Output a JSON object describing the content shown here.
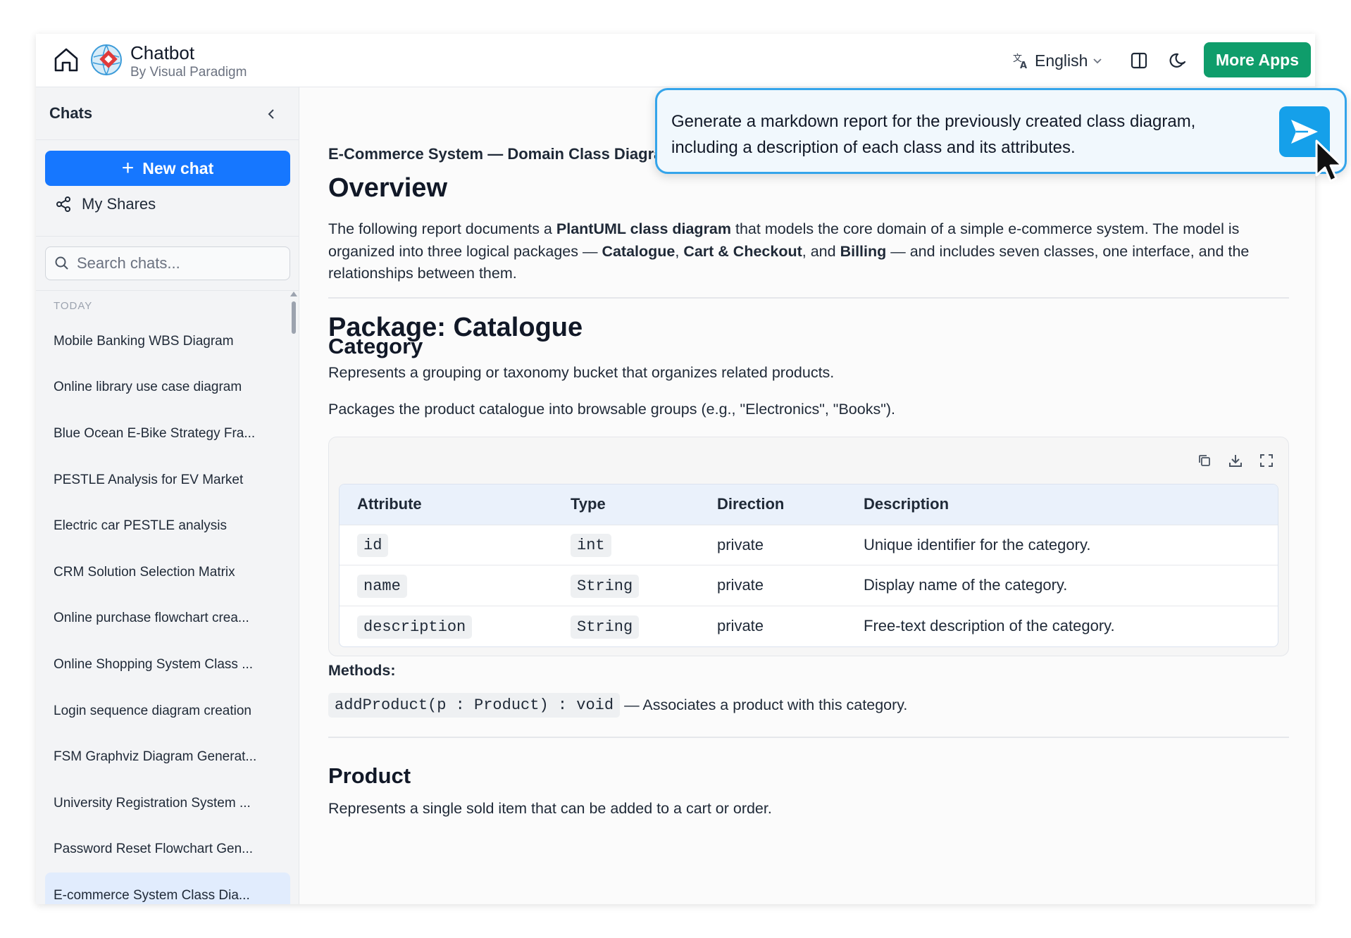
{
  "header": {
    "brand_title": "Chatbot",
    "brand_subtitle": "By Visual Paradigm",
    "language": "English",
    "more_apps_label": "More Apps"
  },
  "sidebar": {
    "title": "Chats",
    "new_chat_label": "New chat",
    "my_shares_label": "My Shares",
    "search_placeholder": "Search chats...",
    "section_label": "TODAY",
    "items": [
      {
        "label": "Mobile Banking WBS Diagram"
      },
      {
        "label": "Online library use case diagram"
      },
      {
        "label": "Blue Ocean E-Bike Strategy Fra..."
      },
      {
        "label": "PESTLE Analysis for EV Market"
      },
      {
        "label": "Electric car PESTLE analysis"
      },
      {
        "label": "CRM Solution Selection Matrix"
      },
      {
        "label": "Online purchase flowchart crea..."
      },
      {
        "label": "Online Shopping System Class ..."
      },
      {
        "label": "Login sequence diagram creation"
      },
      {
        "label": "FSM Graphviz Diagram Generat..."
      },
      {
        "label": "University Registration System ..."
      },
      {
        "label": "Password Reset Flowchart Gen..."
      },
      {
        "label": "E-commerce System Class Dia..."
      }
    ]
  },
  "document": {
    "title": "E-Commerce System — Domain Class Diagram",
    "overview_heading": "Overview",
    "overview_p1_a": "The following report documents a ",
    "overview_p1_b": "PlantUML class diagram",
    "overview_p1_c": " that models the core domain of a simple e-commerce system. The model is organized into three logical packages — ",
    "overview_p1_d": "Catalogue",
    "overview_p1_e": ", ",
    "overview_p1_f": "Cart & Checkout",
    "overview_p1_g": ", and ",
    "overview_p1_h": "Billing",
    "overview_p1_i": " — and includes seven classes, one interface, and the relationships between them.",
    "package_heading": "Package: Catalogue",
    "category_heading": "Category",
    "category_desc": "Represents a grouping or taxonomy bucket that organizes related products.",
    "category_note": "Packages the product catalogue into browsable groups (e.g., \"Electronics\", \"Books\").",
    "table": {
      "headers": [
        "Attribute",
        "Type",
        "Direction",
        "Description"
      ],
      "rows": [
        {
          "attribute": "id",
          "type": "int",
          "direction": "private",
          "description": "Unique identifier for the category."
        },
        {
          "attribute": "name",
          "type": "String",
          "direction": "private",
          "description": "Display name of the category."
        },
        {
          "attribute": "description",
          "type": "String",
          "direction": "private",
          "description": "Free-text description of the category."
        }
      ]
    },
    "methods_label": "Methods:",
    "method_signature": "addProduct(p : Product) : void",
    "method_desc": "— Associates a product with this category.",
    "product_heading": "Product",
    "product_desc": "Represents a single sold item that can be added to a cart or order."
  },
  "prompt": {
    "text": "Generate a markdown report for the previously created class diagram, including a description of each class and its attributes."
  },
  "colors": {
    "accent_blue": "#1677ff",
    "more_apps_green": "#0f9d6b",
    "prompt_border": "#34a4ea",
    "send_button": "#15a0ea"
  }
}
